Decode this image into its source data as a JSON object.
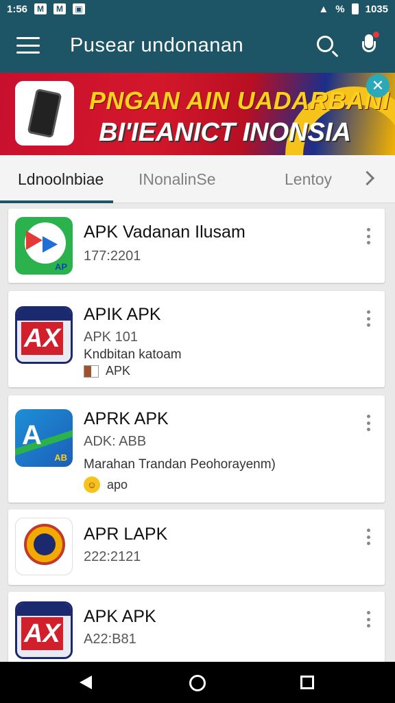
{
  "status_bar": {
    "left_text": "1:56",
    "right_text": "1035",
    "battery_text": "%"
  },
  "app_bar": {
    "title": "Pusear undonanan",
    "search_icon": "search-icon",
    "mic_icon": "mic-icon"
  },
  "banner": {
    "line1": "PNGAN AIN UADARBANI",
    "line2": "BI'IEANICT INONSIA",
    "close_glyph": "✕"
  },
  "tabs": [
    {
      "label": "Ldnoolnbiae",
      "active": true
    },
    {
      "label": "INonalinSe",
      "active": false
    },
    {
      "label": "Lentoy",
      "active": false
    }
  ],
  "apps": [
    {
      "name": "APK Vadanan Ilusam",
      "version": "177:2201",
      "icon": "play-store-icon",
      "desc": "",
      "tag": ""
    },
    {
      "name": "APIK APK",
      "version": "APK 101",
      "desc": "Kndbitan katoam",
      "tag": "APK",
      "icon": "ax-icon"
    },
    {
      "name": "APRK APK",
      "version": "ADK: ABB",
      "desc": "Marahan Trandan Peohorayenm)",
      "tag": "apo",
      "icon": "a-teal-icon"
    },
    {
      "name": "APR LAPK",
      "version": "222:2121",
      "icon": "seal-icon",
      "desc": "",
      "tag": ""
    },
    {
      "name": "APK APK",
      "version": "A22:B81",
      "icon": "ax-icon",
      "desc": "",
      "tag": ""
    }
  ],
  "colors": {
    "primary": "#1d5466",
    "accent": "#e53935",
    "banner_yellow": "#f8d21c"
  }
}
